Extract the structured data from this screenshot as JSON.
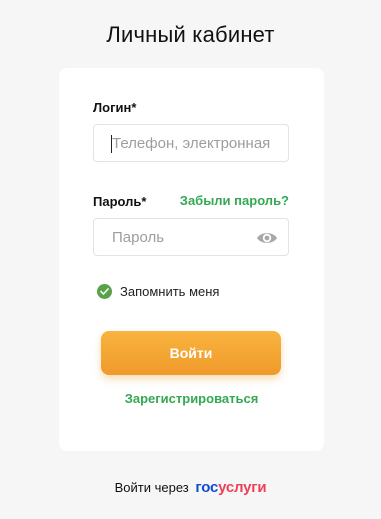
{
  "page": {
    "title": "Личный кабинет"
  },
  "form": {
    "login_label": "Логин*",
    "login_placeholder": "Телефон, электронная",
    "login_value": "",
    "password_label": "Пароль*",
    "forgot_link": "Забыли пароль?",
    "password_placeholder": "Пароль",
    "password_value": "",
    "password_toggle_icon": "eye-icon",
    "remember_label": "Запомнить меня",
    "remember_checked": true,
    "submit_label": "Войти",
    "register_link": "Зарегистрироваться"
  },
  "alt_login": {
    "prefix": "Войти через",
    "brand_part1": "гос",
    "brand_part2": "услуги"
  },
  "colors": {
    "accent_green": "#34a853",
    "button_orange": "#f4a535",
    "brand_blue": "#0d4cd3",
    "brand_red": "#ee3f58"
  }
}
